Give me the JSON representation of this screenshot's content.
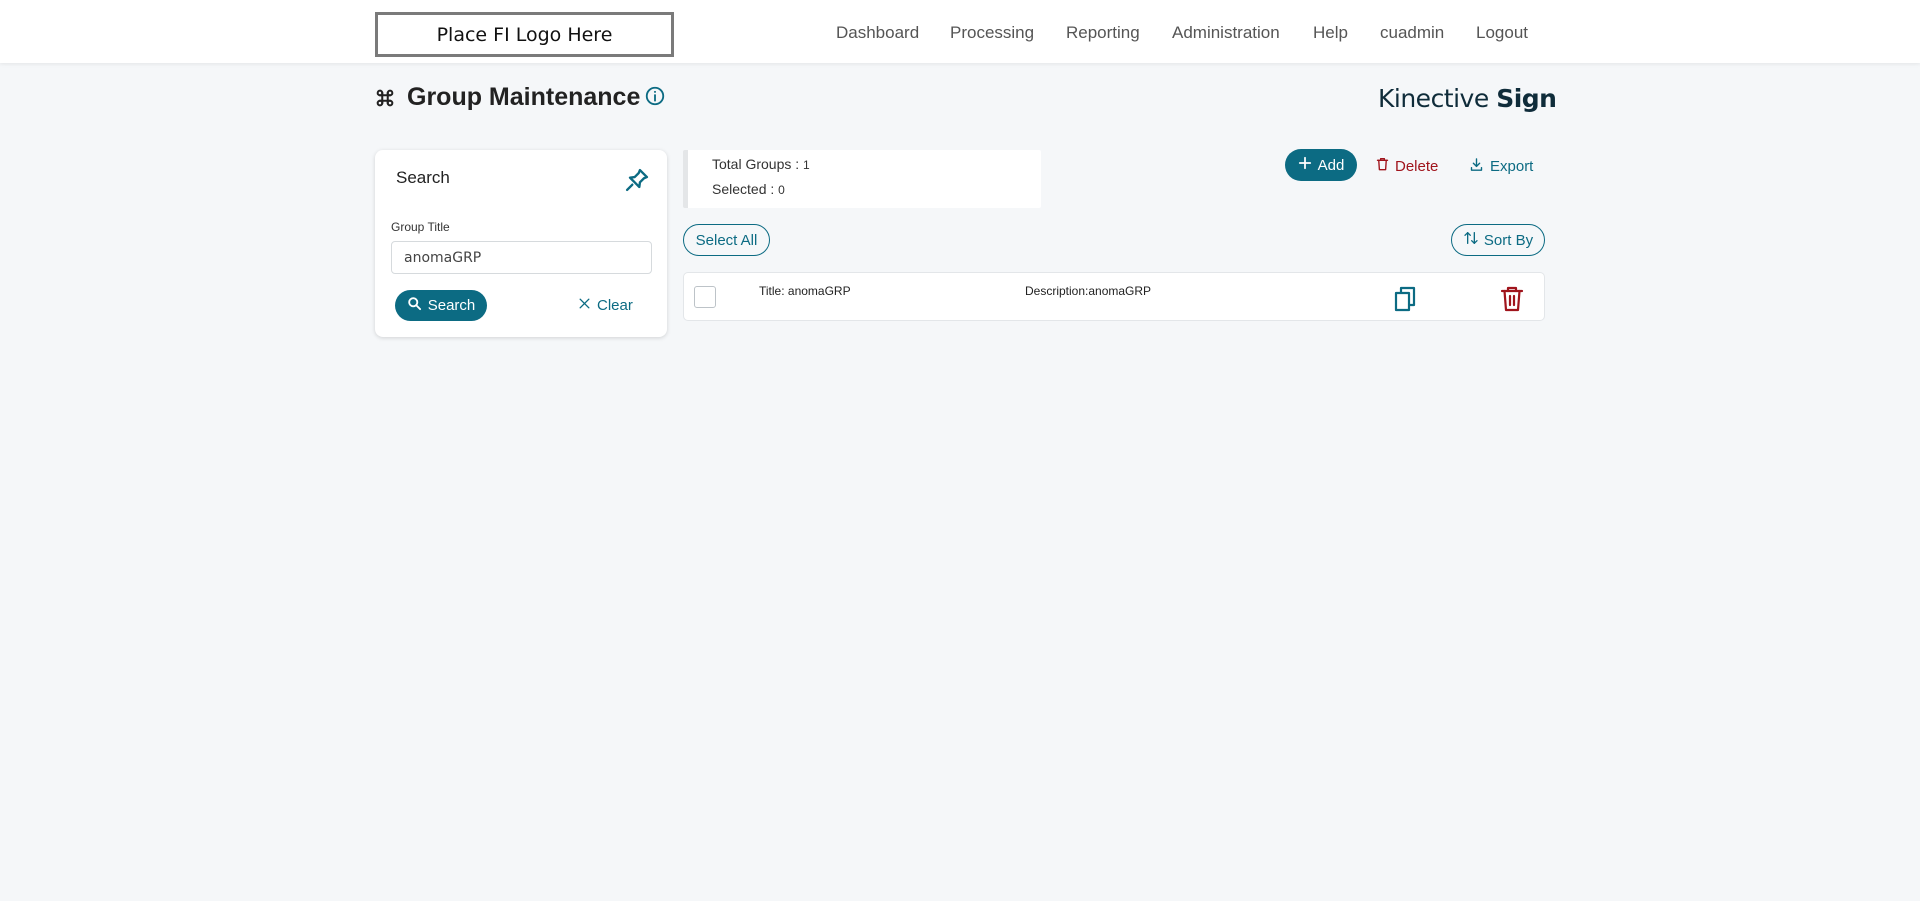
{
  "header": {
    "logo_text": "Place FI Logo Here",
    "nav": [
      {
        "label": "Dashboard"
      },
      {
        "label": "Processing"
      },
      {
        "label": "Reporting"
      },
      {
        "label": "Administration"
      },
      {
        "label": "Help"
      },
      {
        "label": "cuadmin"
      },
      {
        "label": "Logout"
      }
    ]
  },
  "page": {
    "title": "Group Maintenance",
    "brand_light": "Kinective ",
    "brand_bold": "Sign"
  },
  "search": {
    "title": "Search",
    "field_label": "Group Title",
    "field_value": "anomaGRP",
    "search_label": "Search",
    "clear_label": "Clear"
  },
  "summary": {
    "total_label": "Total Groups : ",
    "total_value": "1",
    "selected_label": "Selected : ",
    "selected_value": "0"
  },
  "actions": {
    "add_label": "Add",
    "delete_label": "Delete",
    "export_label": "Export",
    "select_all_label": "Select All",
    "sort_label": "Sort By"
  },
  "rows": [
    {
      "title": "Title: anomaGRP",
      "description": "Description:anomaGRP"
    }
  ],
  "colors": {
    "accent": "#0c6b83",
    "danger": "#a0141c",
    "background": "#f5f7f9"
  }
}
